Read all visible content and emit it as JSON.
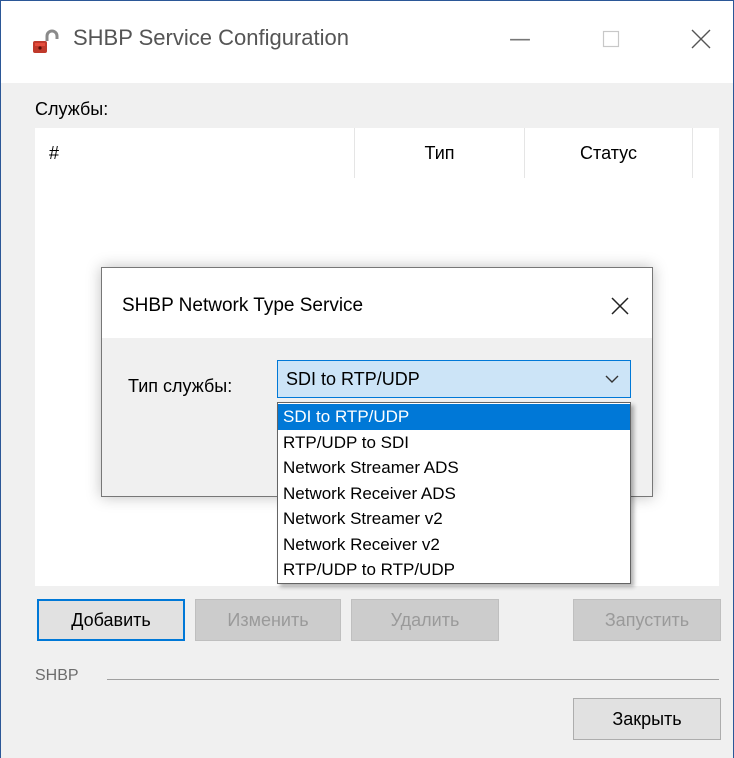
{
  "window": {
    "title": "SHBP Service Configuration",
    "icon": "app-lock-icon"
  },
  "titlebar_buttons": {
    "minimize": "—",
    "maximize": "☐",
    "close": "✕"
  },
  "main": {
    "services_label": "Службы:",
    "columns": [
      "#",
      "Тип",
      "Статус"
    ],
    "buttons": {
      "add": "Добавить",
      "edit": "Изменить",
      "delete": "Удалить",
      "start": "Запустить",
      "close": "Закрыть"
    },
    "group_label": "SHBP"
  },
  "dialog": {
    "title": "SHBP Network Type Service",
    "close": "✕",
    "type_label": "Тип службы:",
    "selected_value": "SDI to RTP/UDP",
    "options": [
      "SDI to RTP/UDP",
      "RTP/UDP to SDI",
      "Network Streamer ADS",
      "Network Receiver ADS",
      "Network Streamer v2",
      "Network Receiver v2",
      "RTP/UDP to RTP/UDP"
    ],
    "selected_index": 0
  },
  "colors": {
    "accent": "#0078d7",
    "combo_bg": "#cce4f7",
    "window_bg": "#f0f0f0",
    "disabled_text": "#9a9a9a"
  }
}
